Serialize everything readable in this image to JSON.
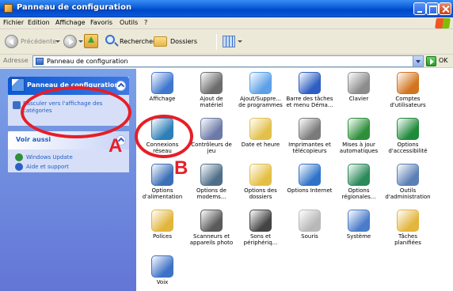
{
  "window": {
    "title": "Panneau de configuration"
  },
  "menubar": {
    "items": [
      "Fichier",
      "Edition",
      "Affichage",
      "Favoris",
      "Outils",
      "?"
    ]
  },
  "toolbar": {
    "back_label": "Précédente",
    "search_label": "Rechercher",
    "folders_label": "Dossiers"
  },
  "address": {
    "label": "Adresse",
    "value": "Panneau de configuration",
    "go_label": "OK"
  },
  "left_pane": {
    "panel_box": {
      "title": "Panneau de configuration",
      "link": "Basculer vers l'affichage des catégories"
    },
    "see_also": {
      "title": "Voir aussi",
      "links": [
        "Windows Update",
        "Aide et support"
      ]
    }
  },
  "items": [
    {
      "label": "Affichage",
      "icon": "display-icon",
      "color": "#3f77cf"
    },
    {
      "label": "Ajout de matériel",
      "icon": "add-hardware-icon",
      "color": "#6c6c6c"
    },
    {
      "label": "Ajout/Suppre... de programmes",
      "icon": "add-remove-programs-icon",
      "color": "#5da0e8"
    },
    {
      "label": "Barre des tâches et menu Déma...",
      "icon": "taskbar-icon",
      "color": "#2d5fc2"
    },
    {
      "label": "Clavier",
      "icon": "keyboard-icon",
      "color": "#8c8c8c"
    },
    {
      "label": "Comptes d'utilisateurs",
      "icon": "user-accounts-icon",
      "color": "#d2751e"
    },
    {
      "label": "Connexions réseau",
      "icon": "network-connections-icon",
      "color": "#2e7fb8"
    },
    {
      "label": "Contrôleurs de jeu",
      "icon": "game-controllers-icon",
      "color": "#6c7aa8"
    },
    {
      "label": "Date et heure",
      "icon": "date-time-icon",
      "color": "#e2c04a"
    },
    {
      "label": "Imprimantes et télécopieurs",
      "icon": "printers-icon",
      "color": "#7a7a7a"
    },
    {
      "label": "Mises à jour automatiques",
      "icon": "automatic-updates-icon",
      "color": "#2e8f3a"
    },
    {
      "label": "Options d'accessibilité",
      "icon": "accessibility-icon",
      "color": "#1f8a3a"
    },
    {
      "label": "Options d'alimentation",
      "icon": "power-options-icon",
      "color": "#3b6fb7"
    },
    {
      "label": "Options de modems...",
      "icon": "phone-modem-icon",
      "color": "#4f6e8a"
    },
    {
      "label": "Options des dossiers",
      "icon": "folder-options-icon",
      "color": "#e5bf44"
    },
    {
      "label": "Options Internet",
      "icon": "internet-options-icon",
      "color": "#2f73c8"
    },
    {
      "label": "Options régionales...",
      "icon": "regional-options-icon",
      "color": "#2b8a5a"
    },
    {
      "label": "Outils d'administration",
      "icon": "admin-tools-icon",
      "color": "#5b7fb5"
    },
    {
      "label": "Polices",
      "icon": "fonts-icon",
      "color": "#e2b53c"
    },
    {
      "label": "Scanneurs et appareils photo",
      "icon": "scanners-cameras-icon",
      "color": "#5a5a5a"
    },
    {
      "label": "Sons et périphériq...",
      "icon": "sounds-icon",
      "color": "#444444"
    },
    {
      "label": "Souris",
      "icon": "mouse-icon",
      "color": "#b8b8b8"
    },
    {
      "label": "Système",
      "icon": "system-icon",
      "color": "#4a7cc9"
    },
    {
      "label": "Tâches planifiées",
      "icon": "scheduled-tasks-icon",
      "color": "#e2b53c"
    },
    {
      "label": "Voix",
      "icon": "speech-icon",
      "color": "#3e72c6"
    }
  ],
  "annotations": {
    "a": "A",
    "b": "B",
    "color": "#e61e27"
  }
}
